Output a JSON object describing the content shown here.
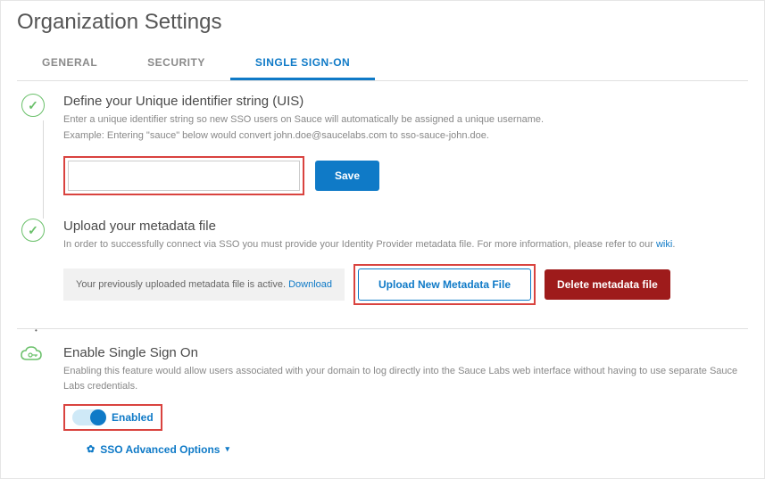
{
  "page_title": "Organization Settings",
  "tabs": {
    "general": "GENERAL",
    "security": "SECURITY",
    "sso": "SINGLE SIGN-ON",
    "active": "sso"
  },
  "uis": {
    "heading": "Define your Unique identifier string (UIS)",
    "desc1": "Enter a unique identifier string so new SSO users on Sauce will automatically be assigned a unique username.",
    "desc2": "Example: Entering \"sauce\" below would convert john.doe@saucelabs.com to sso-sauce-john.doe.",
    "input_value": "",
    "save_label": "Save"
  },
  "metadata": {
    "heading": "Upload your metadata file",
    "desc_pre": "In order to successfully connect via SSO you must provide your Identity Provider metadata file. For more information, please refer to our ",
    "desc_link": "wiki",
    "desc_post": ".",
    "status_pre": "Your previously uploaded metadata file is active. ",
    "download_label": "Download",
    "upload_label": "Upload New Metadata File",
    "delete_label": "Delete metadata file"
  },
  "enable": {
    "heading": "Enable Single Sign On",
    "desc": "Enabling this feature would allow users associated with your domain to log directly into the Sauce Labs web interface without having to use separate Sauce Labs credentials.",
    "toggle_label": "Enabled",
    "toggle_on": true,
    "advanced_label": "SSO Advanced Options"
  }
}
